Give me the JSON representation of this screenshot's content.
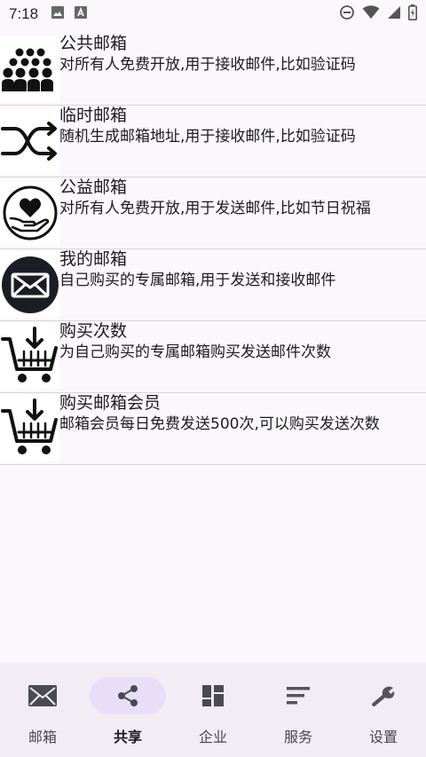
{
  "status_bar": {
    "time": "7:18",
    "icons": [
      "image-icon",
      "text-a-icon",
      "do-not-disturb-icon",
      "wifi-icon",
      "signal-icon",
      "battery-icon"
    ]
  },
  "list": [
    {
      "title": "公共邮箱",
      "desc": "对所有人免费开放,用于接收邮件,比如验证码",
      "icon": "people-group-icon"
    },
    {
      "title": "临时邮箱",
      "desc": "随机生成邮箱地址,用于接收邮件,比如验证码",
      "icon": "shuffle-icon"
    },
    {
      "title": "公益邮箱",
      "desc": "对所有人免费开放,用于发送邮件,比如节日祝福",
      "icon": "heart-hand-icon"
    },
    {
      "title": "我的邮箱",
      "desc": "自己购买的专属邮箱,用于发送和接收邮件",
      "icon": "envelope-circle-icon"
    },
    {
      "title": "购买次数",
      "desc": "为自己购买的专属邮箱购买发送邮件次数",
      "icon": "cart-download-icon"
    },
    {
      "title": "购买邮箱会员",
      "desc": "邮箱会员每日免费发送500次,可以购买发送次数",
      "icon": "cart-download-icon"
    }
  ],
  "bottom_nav": [
    {
      "label": "邮箱",
      "icon": "mail-icon",
      "active": false
    },
    {
      "label": "共享",
      "icon": "share-icon",
      "active": true
    },
    {
      "label": "企业",
      "icon": "dashboard-icon",
      "active": false
    },
    {
      "label": "服务",
      "icon": "sort-lines-icon",
      "active": false
    },
    {
      "label": "设置",
      "icon": "wrench-icon",
      "active": false
    }
  ],
  "colors": {
    "background": "#fcf7fc",
    "nav_background": "#f2ecf4",
    "nav_active_pill": "#e8def8",
    "divider": "#d9d4da"
  }
}
